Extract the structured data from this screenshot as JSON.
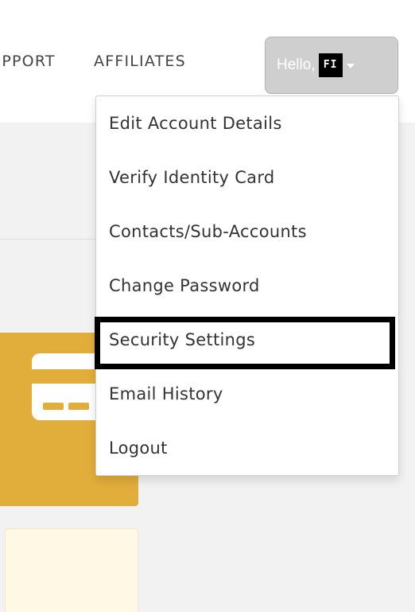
{
  "nav": {
    "support_label": "SUPPORT",
    "affiliates_label": "AFFILIATES"
  },
  "user_menu": {
    "greeting": "Hello,",
    "avatar_initials": "FI",
    "items": [
      {
        "label": "Edit Account Details"
      },
      {
        "label": "Verify Identity Card"
      },
      {
        "label": "Contacts/Sub-Accounts"
      },
      {
        "label": "Change Password"
      },
      {
        "label": "Security Settings",
        "highlighted": true
      },
      {
        "label": "Email History"
      },
      {
        "label": "Logout"
      }
    ]
  },
  "colors": {
    "accent_gold": "#e2ae3b",
    "button_gray": "#cfcfcf",
    "page_bg": "#f2f2f2"
  },
  "icons": {
    "card": "credit-card-icon",
    "caret": "chevron-down-icon"
  }
}
